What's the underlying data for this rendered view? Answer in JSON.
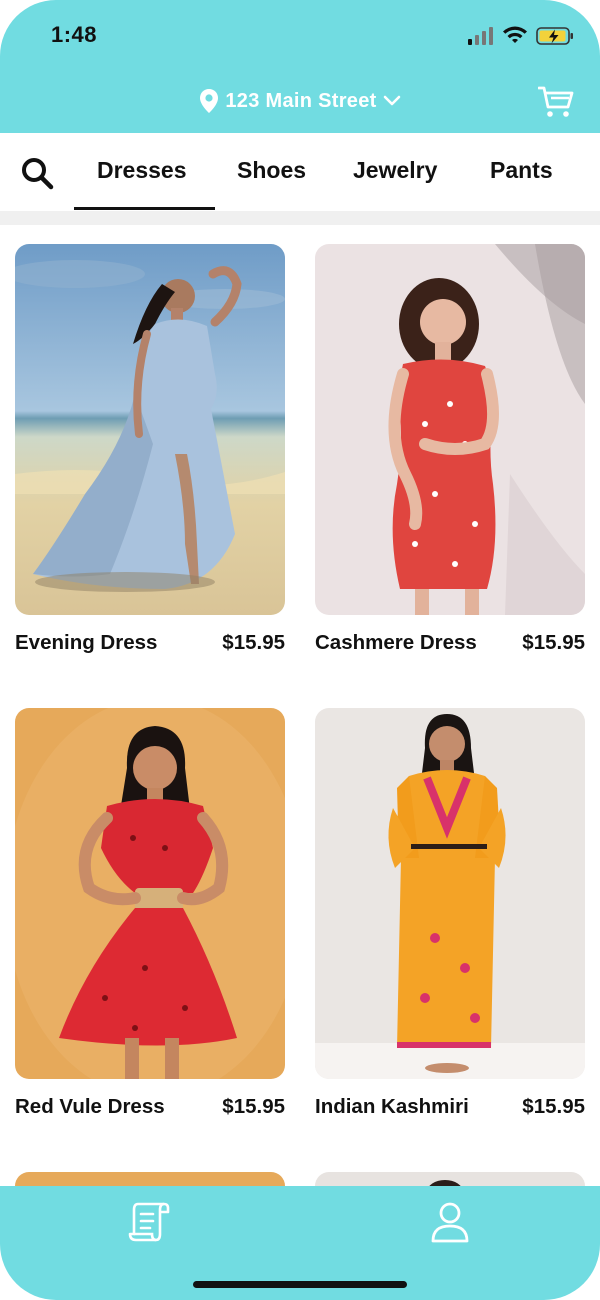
{
  "status_bar": {
    "time": "1:48"
  },
  "header": {
    "location_label": "123 Main Street",
    "location_icon": "map-pin-icon",
    "cart_icon": "cart-icon"
  },
  "tabs": {
    "search_icon": "search-icon",
    "items": [
      {
        "label": "Dresses",
        "selected": true
      },
      {
        "label": "Shoes",
        "selected": false
      },
      {
        "label": "Jewelry",
        "selected": false
      },
      {
        "label": "Pants",
        "selected": false
      }
    ]
  },
  "products": [
    {
      "name": "Evening Dress",
      "price": "$15.95"
    },
    {
      "name": "Cashmere Dress",
      "price": "$15.95"
    },
    {
      "name": "Red Vule Dress",
      "price": "$15.95"
    },
    {
      "name": "Indian Kashmiri",
      "price": "$15.95"
    }
  ],
  "bottom_nav": {
    "items": [
      {
        "icon": "receipt-icon"
      },
      {
        "icon": "profile-icon"
      }
    ]
  },
  "colors": {
    "accent": "#71dce1",
    "text": "#111111",
    "divider": "#f0f0f0"
  }
}
